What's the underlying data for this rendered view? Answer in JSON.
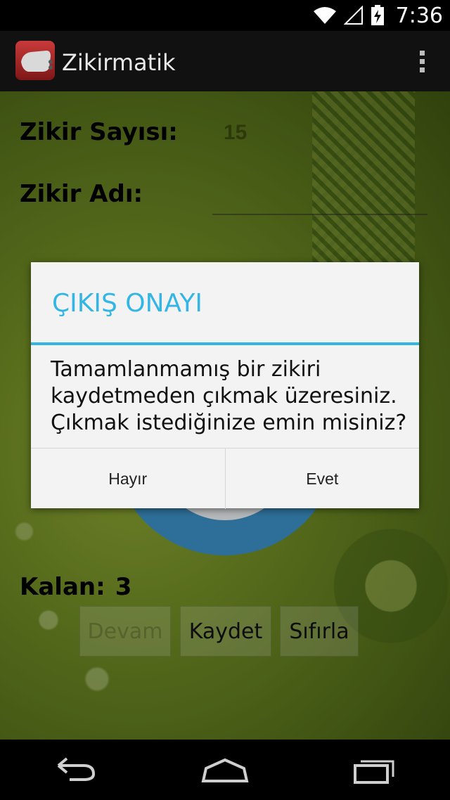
{
  "status_bar": {
    "time": "7:36",
    "icons": [
      "wifi-icon",
      "signal-icon",
      "battery-charging-icon"
    ]
  },
  "action_bar": {
    "app_title": "Zikirmatik",
    "app_icon": "app-icon",
    "overflow_icon": "overflow-menu-icon"
  },
  "form": {
    "count_label": "Zikir Sayısı:",
    "count_value": "15",
    "name_label": "Zikir Adı:",
    "name_value": ""
  },
  "counter": {
    "remaining_label": "Kalan:",
    "remaining_value": "3"
  },
  "buttons": {
    "continue": "Devam",
    "save": "Kaydet",
    "reset": "Sıfırla"
  },
  "dialog": {
    "title": "ÇIKIŞ ONAYI",
    "message": "Tamamlanmamış bir zikiri kaydetmeden çıkmak üzeresiniz. Çıkmak istediğinize emin misiniz?",
    "negative": "Hayır",
    "positive": "Evet"
  },
  "nav_bar": {
    "icons": [
      "back-icon",
      "home-icon",
      "recents-icon"
    ]
  },
  "colors": {
    "accent": "#33b5e5",
    "background_green": "#6f8a24",
    "circle_blue": "#3a8fc3"
  }
}
